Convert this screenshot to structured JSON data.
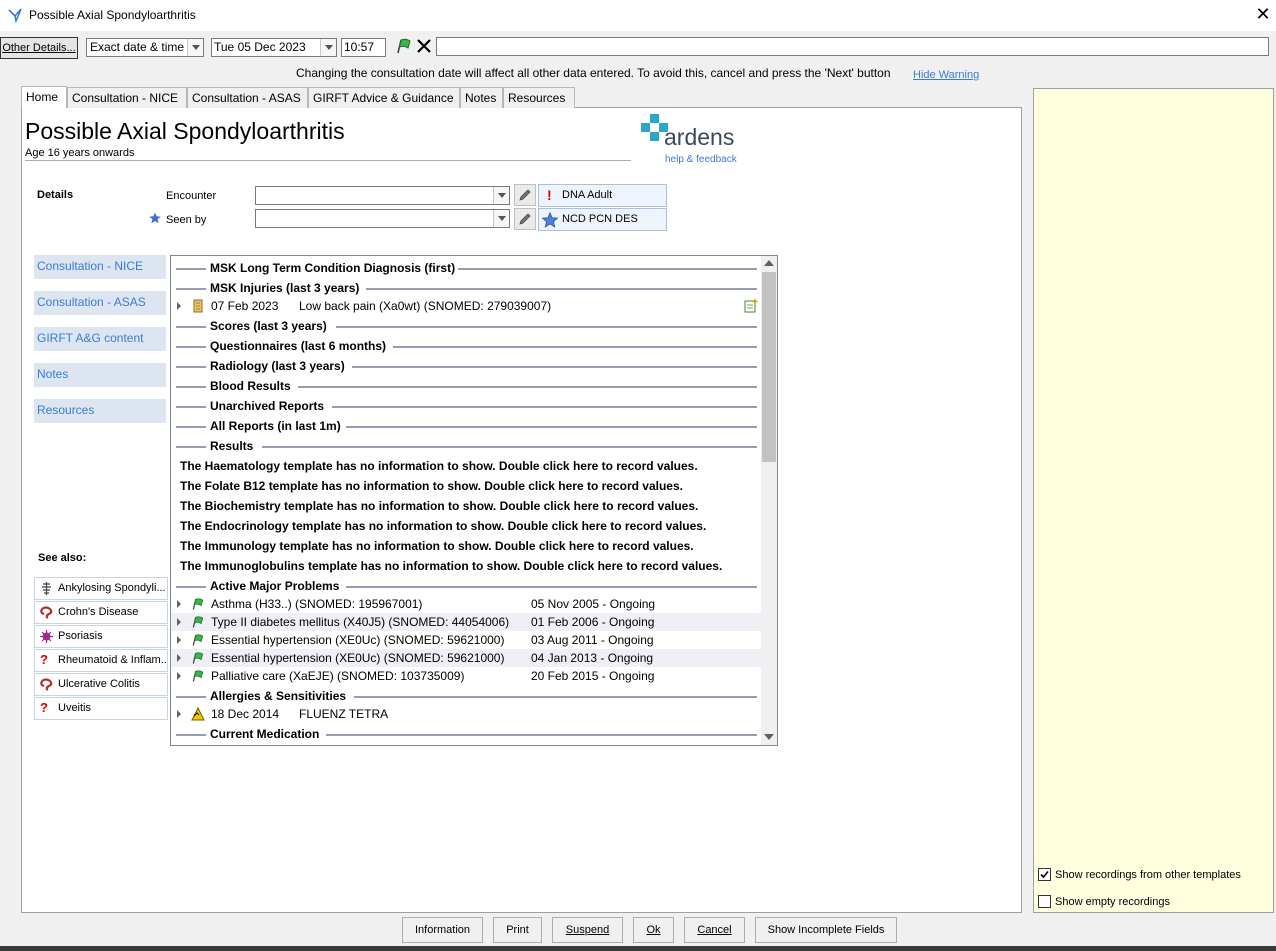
{
  "window": {
    "title": "Possible Axial Spondyloarthritis",
    "close_glyph": "✕"
  },
  "toolbar": {
    "other_details": "Other Details...",
    "date_mode": "Exact date & time",
    "date": "Tue 05 Dec 2023",
    "time": "10:57",
    "free_text": ""
  },
  "warning": {
    "text": "Changing the consultation date will affect all other data entered. To avoid this, cancel and press the 'Next' button",
    "hide_link": "Hide Warning"
  },
  "tabs": [
    "Home",
    "Consultation - NICE",
    "Consultation - ASAS",
    "GIRFT Advice & Guidance",
    "Notes",
    "Resources"
  ],
  "header": {
    "title": "Possible Axial Spondyloarthritis",
    "subtitle": "Age 16 years onwards",
    "logo_text": "ardens",
    "logo_link": "help & feedback"
  },
  "details": {
    "section_label": "Details",
    "encounter_label": "Encounter",
    "encounter_value": "",
    "seen_by_label": "Seen by",
    "seen_by_value": "",
    "tag1": "DNA Adult",
    "tag2": "NCD PCN DES"
  },
  "nav": [
    "Consultation - NICE",
    "Consultation - ASAS",
    "GIRFT A&G content",
    "Notes",
    "Resources"
  ],
  "see_also": {
    "label": "See also:",
    "items": [
      "Ankylosing Spondyli...",
      "Crohn's Disease",
      "Psoriasis",
      "Rheumatoid & Inflam...",
      "Ulcerative Colitis",
      "Uveitis"
    ]
  },
  "records": {
    "sections": [
      "MSK Long Term Condition Diagnosis (first)",
      "MSK Injuries (last 3 years)",
      "Scores (last 3 years)",
      "Questionnaires (last 6 months)",
      "Radiology (last 3 years)",
      "Blood Results",
      "Unarchived Reports",
      "All Reports (in last 1m)",
      "Results",
      "Active Major Problems",
      "Allergies & Sensitivities",
      "Current Medication"
    ],
    "injury": {
      "date": "07 Feb 2023",
      "text": "Low back pain (Xa0wt) (SNOMED: 279039007)"
    },
    "messages": [
      "The Haematology template has no information to show. Double click here to record values.",
      "The Folate B12 template has no information to show. Double click here to record values.",
      "The Biochemistry template has no information to show. Double click here to record values.",
      "The Endocrinology template has no information to show. Double click here to record values.",
      "The Immunology template has no information to show. Double click here to record values.",
      "The Immunoglobulins template has no information to show. Double click here to record values."
    ],
    "problems": [
      {
        "name": "Asthma (H33..) (SNOMED: 195967001)",
        "date": "05 Nov 2005 - Ongoing"
      },
      {
        "name": "Type II diabetes mellitus (X40J5) (SNOMED: 44054006)",
        "date": "01 Feb 2006 - Ongoing"
      },
      {
        "name": "Essential hypertension (XE0Uc) (SNOMED: 59621000)",
        "date": "03 Aug 2011 - Ongoing"
      },
      {
        "name": "Essential hypertension (XE0Uc) (SNOMED: 59621000)",
        "date": "04 Jan 2013 - Ongoing"
      },
      {
        "name": "Palliative care (XaEJE) (SNOMED: 103735009)",
        "date": "20 Feb 2015 - Ongoing"
      }
    ],
    "allergy": {
      "date": "18 Dec 2014",
      "text": "FLUENZ TETRA"
    }
  },
  "right_panel": {
    "show_other_templates": "Show recordings from other templates",
    "show_other_checked": true,
    "show_empty": "Show empty recordings",
    "show_empty_checked": false
  },
  "buttons": [
    "Information",
    "Print",
    "Suspend",
    "Ok",
    "Cancel",
    "Show Incomplete Fields"
  ],
  "colors": {
    "accent_blue": "#3a7bd5",
    "logo_teal": "#2aa7c9",
    "panel_yellow": "#ffffe0"
  }
}
